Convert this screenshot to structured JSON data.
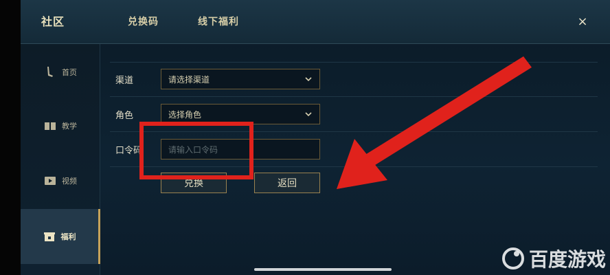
{
  "header": {
    "tabs": [
      {
        "label": "社区"
      },
      {
        "label": "兑换码"
      },
      {
        "label": "线下福利"
      }
    ],
    "close": "×"
  },
  "sidebar": {
    "items": [
      {
        "label": "首页",
        "icon": "sword-icon"
      },
      {
        "label": "教学",
        "icon": "book-icon"
      },
      {
        "label": "视频",
        "icon": "video-icon"
      },
      {
        "label": "福利",
        "icon": "gift-icon",
        "active": true
      }
    ]
  },
  "form": {
    "channel": {
      "label": "渠道",
      "value": "请选择渠道"
    },
    "role": {
      "label": "角色",
      "value": "选择角色"
    },
    "code": {
      "label": "口令码",
      "placeholder": "请输入口令码"
    },
    "redeem_label": "兑换",
    "back_label": "返回"
  },
  "watermark": {
    "text": "百度游戏"
  },
  "colors": {
    "accent_gold": "#c7a35a",
    "annotation_red": "#e0221c"
  }
}
